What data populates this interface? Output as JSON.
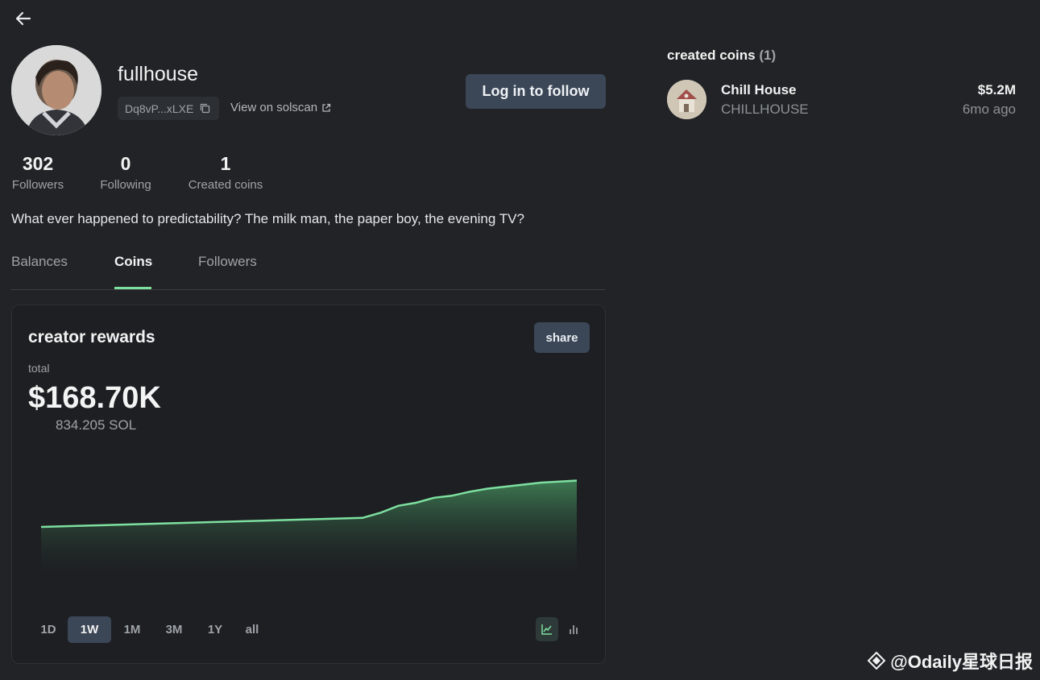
{
  "profile": {
    "username": "fullhouse",
    "address_short": "Dq8vP...xLXE",
    "solscan_label": "View on solscan",
    "follow_label": "Log in to follow",
    "bio": "What ever happened to predictability? The milk man, the paper boy, the evening TV?"
  },
  "stats": [
    {
      "value": "302",
      "label": "Followers"
    },
    {
      "value": "0",
      "label": "Following"
    },
    {
      "value": "1",
      "label": "Created coins"
    }
  ],
  "tabs": [
    {
      "label": "Balances",
      "active": false
    },
    {
      "label": "Coins",
      "active": true
    },
    {
      "label": "Followers",
      "active": false
    }
  ],
  "rewards": {
    "title": "creator rewards",
    "share_label": "share",
    "total_label": "total",
    "total_value": "$168.70K",
    "total_sol": "834.205 SOL",
    "ranges": [
      "1D",
      "1W",
      "1M",
      "3M",
      "1Y",
      "all"
    ],
    "active_range": "1W",
    "line_color": "#7ee0a0",
    "chart_data": {
      "type": "area",
      "x": [
        0,
        1,
        2,
        3,
        4,
        5,
        6,
        7,
        8,
        9,
        10,
        11,
        12,
        13,
        14,
        15,
        16,
        17,
        18,
        19,
        20,
        21,
        22,
        23,
        24,
        25,
        26,
        27,
        28,
        29,
        30
      ],
      "values": [
        112,
        112.5,
        113,
        113.5,
        114,
        114.5,
        115,
        115.5,
        116,
        116.5,
        117,
        117.5,
        118,
        118.5,
        119,
        119.5,
        120,
        120.5,
        121,
        126,
        133,
        136,
        141,
        143,
        147,
        150,
        152,
        154,
        156,
        157,
        158
      ],
      "ylim": [
        60,
        180
      ]
    }
  },
  "created_coins": {
    "title": "created coins",
    "count": "(1)",
    "items": [
      {
        "name": "Chill House",
        "ticker": "CHILLHOUSE",
        "market_cap": "$5.2M",
        "age": "6mo ago"
      }
    ]
  },
  "watermark": "@Odaily星球日报"
}
